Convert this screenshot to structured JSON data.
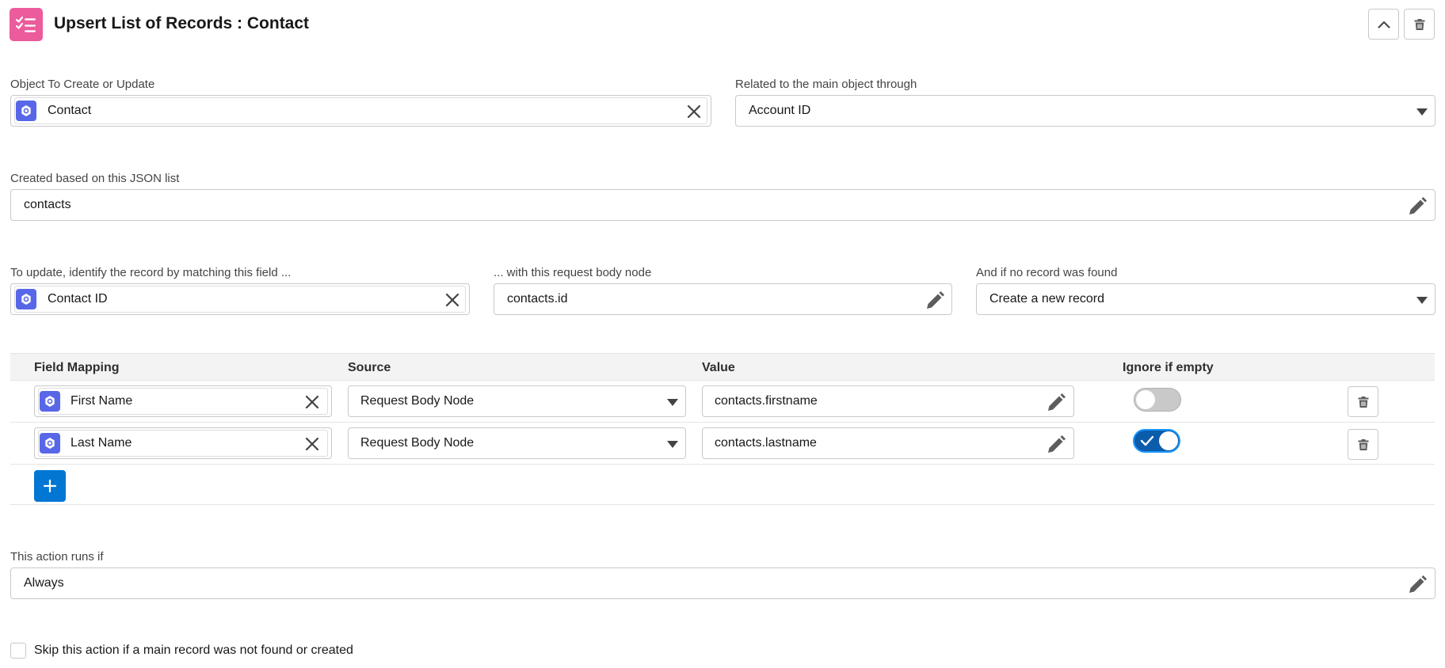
{
  "header": {
    "title": "Upsert List of Records : Contact",
    "icon": "checklist-icon",
    "accent": "#ec5b9c"
  },
  "object_field": {
    "label": "Object To Create or Update",
    "value": "Contact"
  },
  "related_field": {
    "label": "Related to the main object through",
    "value": "Account ID"
  },
  "json_field": {
    "label": "Created based on this JSON list",
    "value": "contacts"
  },
  "match_field": {
    "label": "To update, identify the record by matching this field ...",
    "value": "Contact ID"
  },
  "body_node_field": {
    "label": "... with this request body node",
    "value": "contacts.id"
  },
  "not_found_field": {
    "label": "And if no record was found",
    "value": "Create a new record"
  },
  "mapping_table": {
    "headers": {
      "field": "Field Mapping",
      "source": "Source",
      "value": "Value",
      "ignore": "Ignore if empty"
    },
    "rows": [
      {
        "field": "First Name",
        "source": "Request Body Node",
        "value": "contacts.firstname",
        "ignore_if_empty": false
      },
      {
        "field": "Last Name",
        "source": "Request Body Node",
        "value": "contacts.lastname",
        "ignore_if_empty": true
      }
    ]
  },
  "condition_field": {
    "label": "This action runs if",
    "value": "Always"
  },
  "skip_checkbox": {
    "label": "Skip this action if a main record was not found or created",
    "checked": false
  },
  "colors": {
    "object_icon": "#5867e8",
    "primary_button": "#0176d3",
    "toggle_on": "#0b5cab"
  }
}
